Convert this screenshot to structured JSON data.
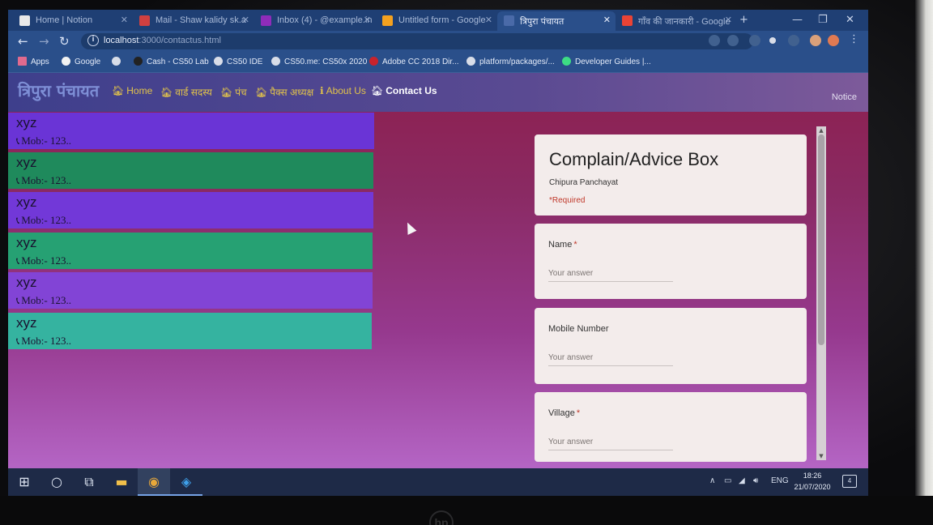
{
  "browser": {
    "tabs": [
      {
        "title": "Home | Notion",
        "fav": "#e9e9e9"
      },
      {
        "title": "Mail - Shaw kalidy sk.a",
        "fav": "#d04040"
      },
      {
        "title": "Inbox (4) - @example.in",
        "fav": "#8f2cba"
      },
      {
        "title": "Untitled form - Google",
        "fav": "#f4a11f"
      },
      {
        "title": "त्रिपुरा पंचायत",
        "fav": "#4a6aa8"
      },
      {
        "title": "गाँव की जानकारी - Google",
        "fav": "#ea4335"
      }
    ],
    "url_host": "localhost",
    "url_rest": ":3000/contactus.html",
    "bookmarks": [
      "Apps",
      "Google",
      "",
      "Cash - CS50 Lab",
      "CS50 IDE",
      "CS50.me: CS50x 2020",
      "Adobe CC 2018 Dir...",
      "platform/packages/...",
      "Developer Guides |..."
    ]
  },
  "site": {
    "brand": "त्रिपुरा पंचायत",
    "nav": [
      {
        "label": "Home"
      },
      {
        "label": "वार्ड सदस्य"
      },
      {
        "label": "पंच"
      },
      {
        "label": "पैक्स अध्यक्ष"
      },
      {
        "label": "About Us"
      },
      {
        "label": "Contact Us"
      }
    ],
    "notice": "Notice"
  },
  "contacts": [
    {
      "name": "xyz",
      "mobile": "Mob:- 123..",
      "color": "#6a34d6"
    },
    {
      "name": "xyz",
      "mobile": "Mob:- 123..",
      "color": "#1f8a5c"
    },
    {
      "name": "xyz",
      "mobile": "Mob:- 123..",
      "color": "#7238d8"
    },
    {
      "name": "xyz",
      "mobile": "Mob:- 123..",
      "color": "#26a173"
    },
    {
      "name": "xyz",
      "mobile": "Mob:- 123..",
      "color": "#8244d6"
    },
    {
      "name": "xyz",
      "mobile": "Mob:- 123..",
      "color": "#35b3a0"
    }
  ],
  "form": {
    "title": "Complain/Advice Box",
    "subtitle": "Chipura Panchayat",
    "required_note": "*Required",
    "questions": [
      {
        "label": "Name",
        "required": "*",
        "placeholder": "Your answer"
      },
      {
        "label": "Mobile Number",
        "required": "",
        "placeholder": "Your answer"
      },
      {
        "label": "Village",
        "required": "*",
        "placeholder": "Your answer"
      }
    ]
  },
  "taskbar": {
    "lang": "ENG",
    "time": "18:26",
    "date": "21/07/2020",
    "notifications": "4"
  },
  "hp_logo": "hp"
}
